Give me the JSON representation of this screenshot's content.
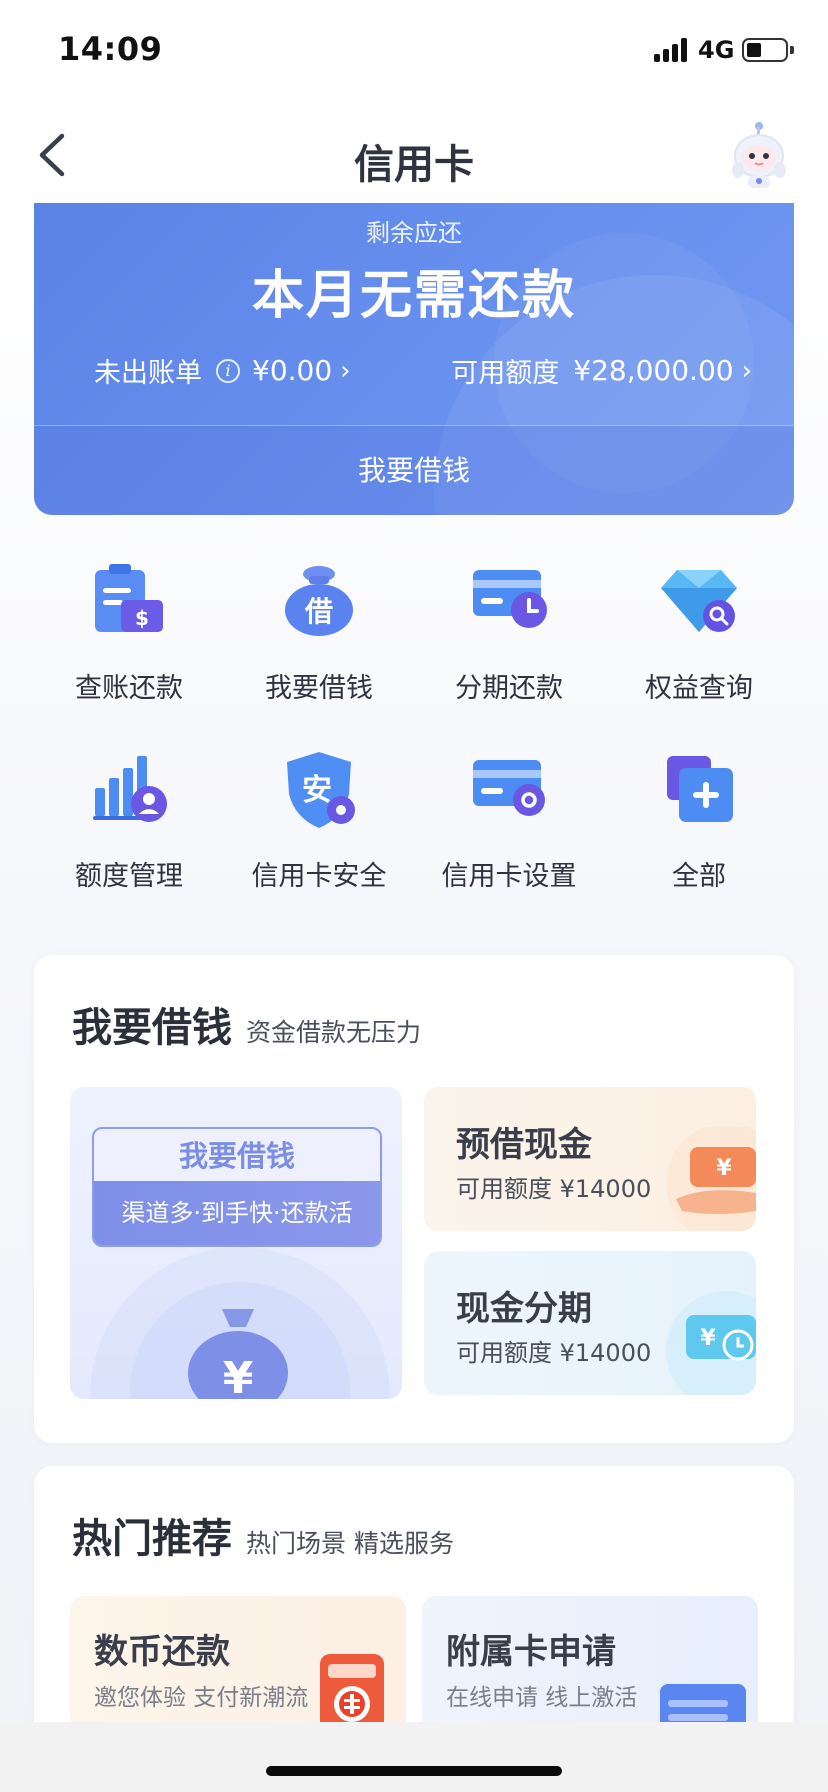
{
  "status_bar": {
    "time": "14:09",
    "network": "4G"
  },
  "nav": {
    "title": "信用卡"
  },
  "hero": {
    "label": "剩余应还",
    "status": "本月无需还款",
    "unbilled_label": "未出账单",
    "unbilled_amount": "¥0.00",
    "available_label": "可用额度",
    "available_amount": "¥28,000.00",
    "borrow_button": "我要借钱",
    "chevron": "›",
    "colors": {
      "start": "#5b83e6",
      "end": "#7199f1"
    }
  },
  "grid": {
    "items": [
      {
        "label": "查账还款",
        "icon": "bill-repay-icon"
      },
      {
        "label": "我要借钱",
        "icon": "borrow-bag-icon",
        "glyph": "借"
      },
      {
        "label": "分期还款",
        "icon": "installment-card-icon"
      },
      {
        "label": "权益查询",
        "icon": "diamond-search-icon"
      },
      {
        "label": "额度管理",
        "icon": "limit-chart-icon"
      },
      {
        "label": "信用卡安全",
        "icon": "security-shield-icon",
        "glyph": "安"
      },
      {
        "label": "信用卡设置",
        "icon": "card-settings-icon"
      },
      {
        "label": "全部",
        "icon": "all-plus-icon"
      }
    ]
  },
  "loan": {
    "title": "我要借钱",
    "subtitle": "资金借款无压力",
    "banner_title": "我要借钱",
    "banner_slogan": "渠道多·到手快·还款活",
    "bag_glyph": "¥",
    "cash": {
      "title": "预借现金",
      "subtitle": "可用额度 ¥14000",
      "glyph": "¥"
    },
    "installment": {
      "title": "现金分期",
      "subtitle": "可用额度 ¥14000",
      "glyph": "¥"
    }
  },
  "hot": {
    "title": "热门推荐",
    "subtitle": "热门场景 精选服务",
    "items": [
      {
        "title": "数币还款",
        "subtitle": "邀您体验 支付新潮流",
        "icon": "digital-rmb-icon"
      },
      {
        "title": "附属卡申请",
        "subtitle": "在线申请 线上激活",
        "icon": "card-stack-icon"
      }
    ]
  },
  "accent_color": "#5b7ef0"
}
